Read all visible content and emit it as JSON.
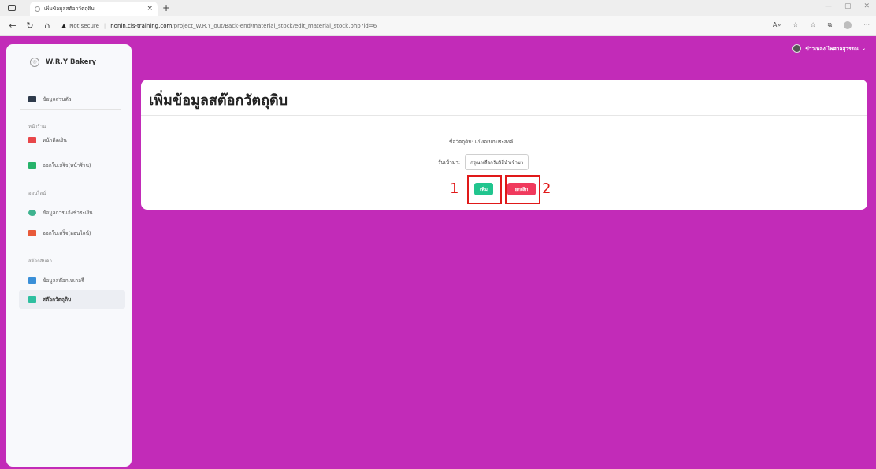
{
  "browser": {
    "tab_title": "เพิ่มข้อมูลสต๊อกวัตถุดิบ",
    "tab_close": "×",
    "new_tab": "+",
    "security_warning": "Not secure",
    "url_host": "nonin.cis-training.com",
    "url_path": "/project_W.R.Y_out/Back-end/material_stock/edit_material_stock.php?id=6"
  },
  "sidebar": {
    "brand": "W.R.Y Bakery",
    "profile_item": "ข้อมูลส่วนตัว",
    "section_storefront": "หน้าร้าน",
    "storefront_items": [
      "หน้าคิดเงิน",
      "ออกใบเสร็จ(หน้าร้าน)"
    ],
    "section_online": "ออนไลน์",
    "online_items": [
      "ข้อมูลการแจ้งชำระเงิน",
      "ออกใบเสร็จ(ออนไลน์)"
    ],
    "section_stock": "สต๊อกสินค้า",
    "stock_items": [
      "ข้อมูลสต๊อกเบเกอรี่",
      "สต๊อกวัตถุดิบ"
    ]
  },
  "user": {
    "name": "ข้าวเพลง ไพศาลสุวรรณ"
  },
  "main": {
    "page_title": "เพิ่มข้อมูลสต๊อกวัตถุดิบ",
    "material_label": "ชื่อวัตถุดิบ: แป้งอเนกประสงค์",
    "receive_label": "รับเข้ามา:",
    "receive_placeholder": "กรุณาเลือกรับวิธีนำเข้ามา",
    "save_button": "เพิ่ม",
    "cancel_button": "ยกเลิก"
  },
  "annotations": {
    "mark_1": "1",
    "mark_2": "2"
  },
  "colors": {
    "page_background": "#c22bb8",
    "save_button": "#21c58e",
    "cancel_button": "#f03a5d",
    "highlight": "#e01919"
  }
}
